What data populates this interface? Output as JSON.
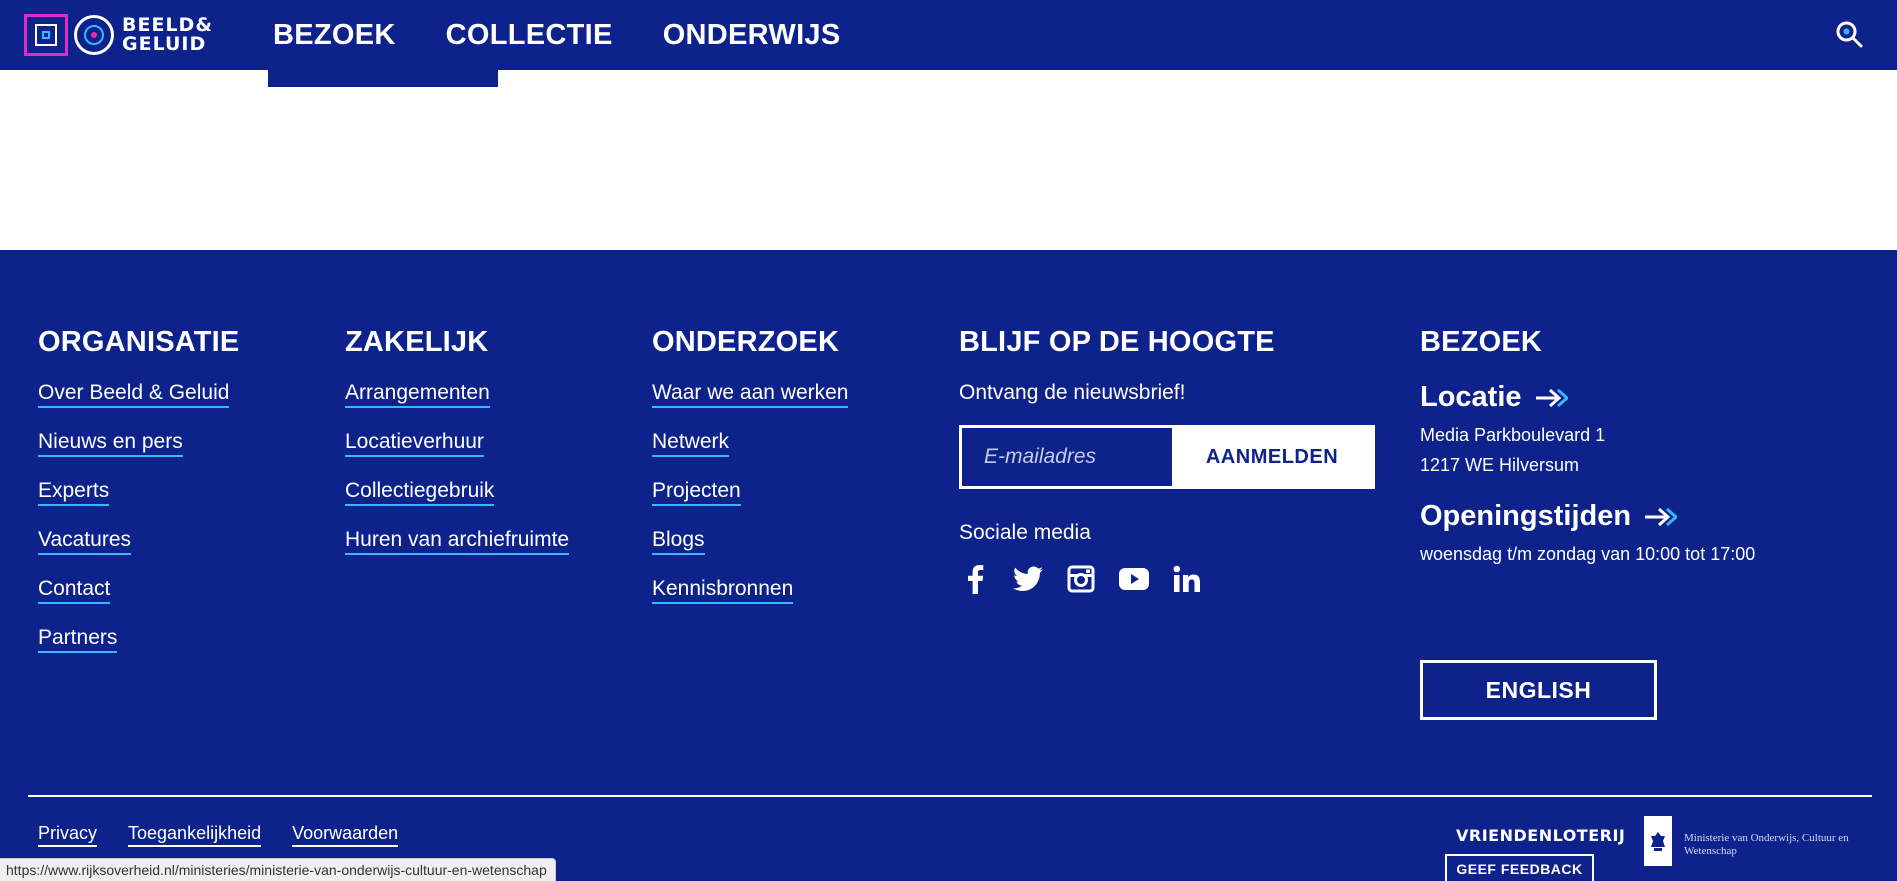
{
  "header": {
    "logo_line1": "BEELD&",
    "logo_line2": "GELUID",
    "nav": [
      {
        "label": "BEZOEK"
      },
      {
        "label": "COLLECTIE"
      },
      {
        "label": "ONDERWIJS"
      }
    ]
  },
  "footer": {
    "organisatie": {
      "title": "ORGANISATIE",
      "links": [
        "Over Beeld & Geluid",
        "Nieuws en pers",
        "Experts",
        "Vacatures",
        "Contact",
        "Partners"
      ]
    },
    "zakelijk": {
      "title": "ZAKELIJK",
      "links": [
        "Arrangementen",
        "Locatieverhuur",
        "Collectiegebruik",
        "Huren van archiefruimte"
      ]
    },
    "onderzoek": {
      "title": "ONDERZOEK",
      "links": [
        "Waar we aan werken",
        "Netwerk",
        "Projecten",
        "Blogs",
        "Kennisbronnen"
      ]
    },
    "newsletter": {
      "title": "BLIJF OP DE HOOGTE",
      "label": "Ontvang de nieuwsbrief!",
      "placeholder": "E-mailadres",
      "button": "AANMELDEN",
      "social_label": "Sociale media",
      "social_icons": [
        "facebook-icon",
        "twitter-icon",
        "instagram-icon",
        "youtube-icon",
        "linkedin-icon"
      ]
    },
    "bezoek": {
      "title": "BEZOEK",
      "locatie_title": "Locatie",
      "address_line1": "Media Parkboulevard 1",
      "address_line2": "1217 WE Hilversum",
      "opening_title": "Openingstijden",
      "opening_hours": "woensdag t/m zondag van 10:00 tot 17:00",
      "english_button": "ENGLISH"
    },
    "bottom_links": [
      "Privacy",
      "Toegankelijkheid",
      "Voorwaarden"
    ],
    "vriendenloterij": "VRIENDENLOTERIJ",
    "ministry": "Ministerie van Onderwijs, Cultuur en Wetenschap",
    "feedback_button": "GEEF FEEDBACK"
  },
  "status_bar": {
    "url": "https://www.rijksoverheid.nl/ministeries/ministerie-van-onderwijs-cultuur-en-wetenschap"
  },
  "colors": {
    "brand_blue": "#0e228c",
    "accent_cyan": "#37b7ff",
    "accent_magenta": "#e02bc4",
    "white": "#ffffff"
  }
}
